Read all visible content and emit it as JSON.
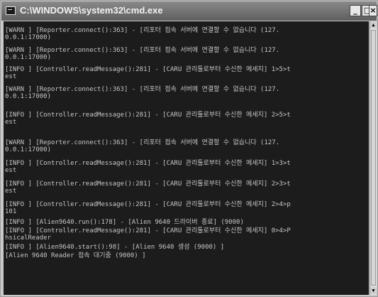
{
  "window": {
    "title": "C:\\WINDOWS\\system32\\cmd.exe",
    "controls": {
      "minimize": "_",
      "maximize": "□",
      "close": "×"
    }
  },
  "console": {
    "lines": [
      "[WARN ] [Reporter.connect():363] - [리포터 접속 서버에 연결할 수 없습니다 (127.",
      "0.0.1:17000)",
      "[WARN ] [Reporter.connect():363] - [리포터 접속 서버에 연결할 수 없습니다 (127.",
      "0.0.1:17000)",
      "[INFO ] [Controller.readMessage():281] - [CARU 관리툴로부터 수신한 메세지] 1>5>t",
      "est",
      "[WARN ] [Reporter.connect():363] - [리포터 접속 서버에 연결할 수 없습니다 (127.",
      "0.0.1:17000)",
      "[INFO ] [Controller.readMessage():281] - [CARU 관리툴로부터 수신한 메세지] 2>5>t",
      "est",
      "[WARN ] [Reporter.connect():363] - [리포터 접속 서버에 연결할 수 없습니다 (127.",
      "0.0.1:17000)",
      "[INFO ] [Controller.readMessage():281] - [CARU 관리툴로부터 수신한 메세지] 1>3>t",
      "est",
      "[INFO ] [Controller.readMessage():281] - [CARU 관리툴로부터 수신한 메세지] 2>3>t",
      "est",
      "[INFO ] [Controller.readMessage():281] - [CARU 관리툴로부터 수신한 메세지] 2>4>p",
      "101",
      "[INFO ] [Alien9640.run():178] - [Alien 9640 드라이버 종료] (9000)",
      "[INFO ] [Controller.readMessage():281] - [CARU 관리툴로부터 수신한 메세지] 0>4>P",
      "hsicalReader",
      "[INFO ] [Alien9640.start():98] - [Alien 9640 생성 (9000) ]",
      "[Alien 9640 Reader 접속 대기중 (9000) ]"
    ]
  }
}
